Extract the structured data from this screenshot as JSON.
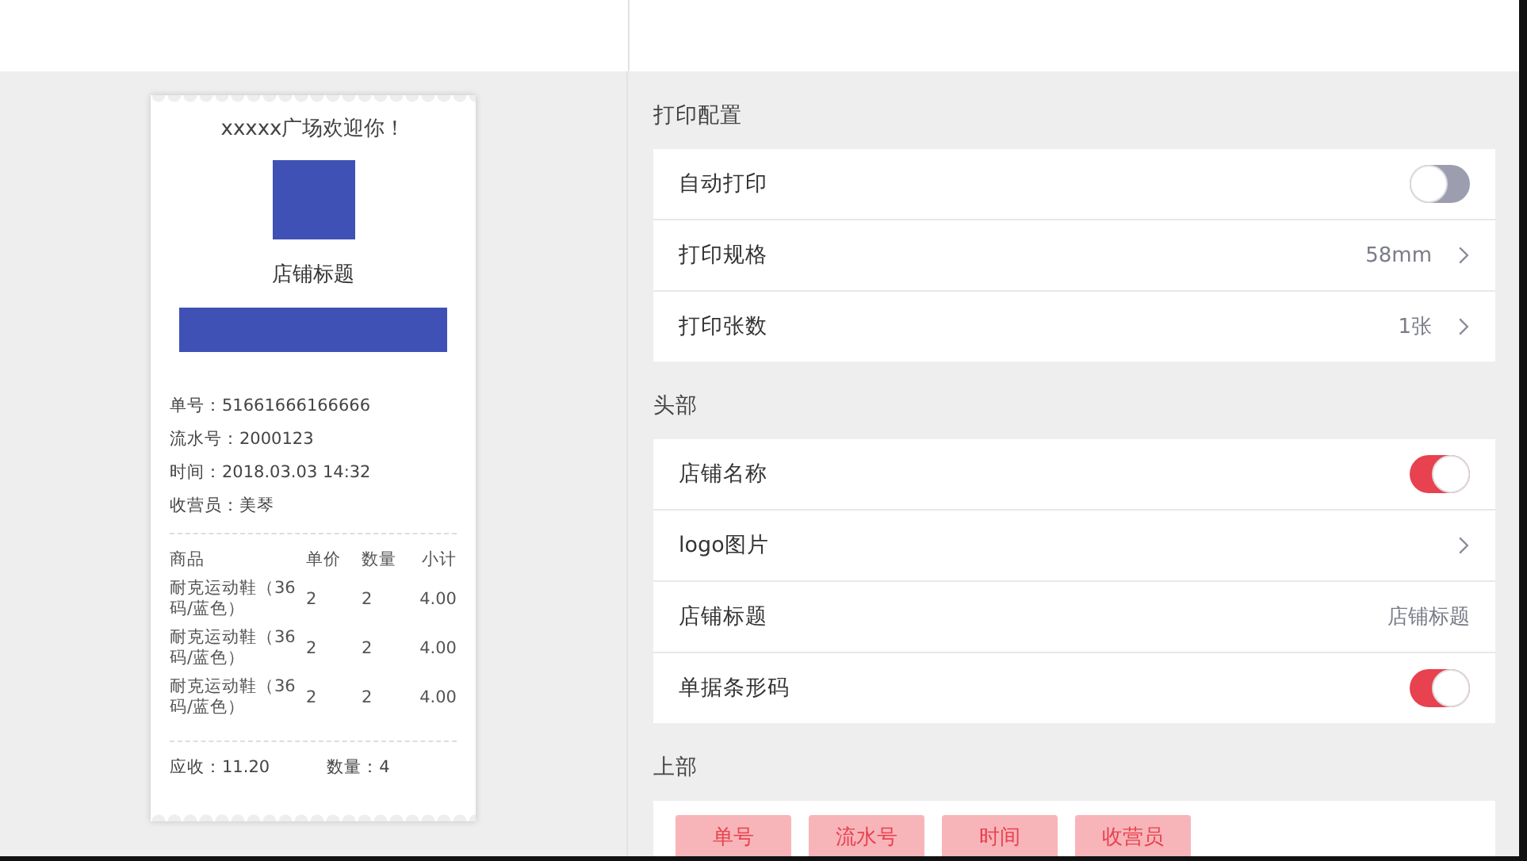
{
  "receipt": {
    "welcome": "xxxxx广场欢迎你！",
    "store_title": "店铺标题",
    "info": [
      "单号：51661666166666",
      "流水号：2000123",
      "时间：2018.03.03 14:32",
      "收营员：美琴"
    ],
    "columns": [
      "商品",
      "单价",
      "数量",
      "小计"
    ],
    "items": [
      [
        "耐克运动鞋（36码/蓝色）",
        "2",
        "2",
        "4.00"
      ],
      [
        "耐克运动鞋（36码/蓝色）",
        "2",
        "2",
        "4.00"
      ],
      [
        "耐克运动鞋（36码/蓝色）",
        "2",
        "2",
        "4.00"
      ]
    ],
    "summary": [
      "应收：11.20",
      "数量：4"
    ]
  },
  "sections": [
    {
      "title": "打印配置",
      "rows": [
        {
          "kind": "toggle",
          "label": "自动打印",
          "on": false
        },
        {
          "kind": "link",
          "label": "打印规格",
          "value": "58mm"
        },
        {
          "kind": "link",
          "label": "打印张数",
          "value": "1张"
        }
      ]
    },
    {
      "title": "头部",
      "rows": [
        {
          "kind": "toggle",
          "label": "店铺名称",
          "on": true
        },
        {
          "kind": "link",
          "label": "logo图片"
        },
        {
          "kind": "text",
          "label": "店铺标题",
          "value": "店铺标题"
        },
        {
          "kind": "toggle",
          "label": "单据条形码",
          "on": true
        }
      ]
    },
    {
      "title": "上部",
      "tags": [
        "单号",
        "流水号",
        "时间",
        "收营员"
      ]
    }
  ]
}
